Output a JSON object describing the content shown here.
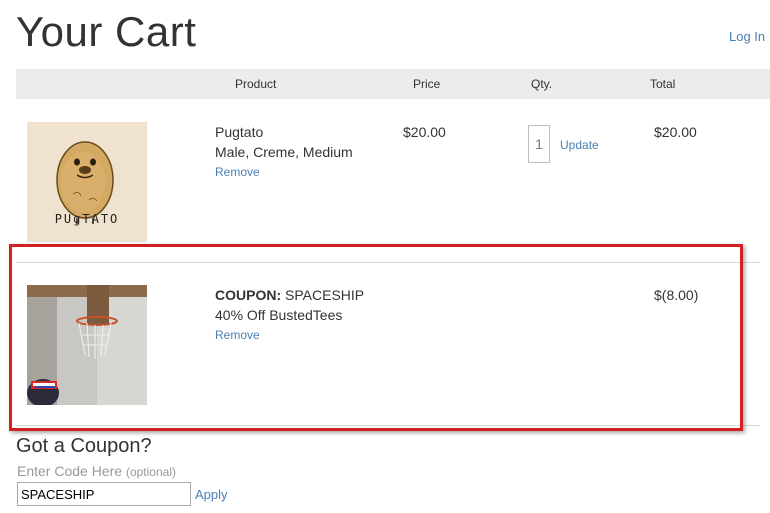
{
  "header": {
    "title": "Your Cart",
    "login_label": "Log In"
  },
  "table": {
    "columns": [
      "Product",
      "Price",
      "Qty.",
      "Total"
    ]
  },
  "items": [
    {
      "image_caption": "PUgTATO",
      "name": "Pugtato",
      "variant": "Male, Creme, Medium",
      "remove_label": "Remove",
      "price": "$20.00",
      "qty": "1",
      "update_label": "Update",
      "total": "$20.00"
    }
  ],
  "coupon_item": {
    "label": "COUPON:",
    "code": "SPACESHIP",
    "description": "40% Off BustedTees",
    "remove_label": "Remove",
    "total": "$(8.00)"
  },
  "coupon_form": {
    "heading": "Got a Coupon?",
    "label": "Enter Code Here",
    "optional": "(optional)",
    "value": "SPACESHIP",
    "apply_label": "Apply"
  },
  "colors": {
    "link": "#4a7fb5",
    "highlight": "#d42020",
    "header_bg": "#ececec"
  }
}
